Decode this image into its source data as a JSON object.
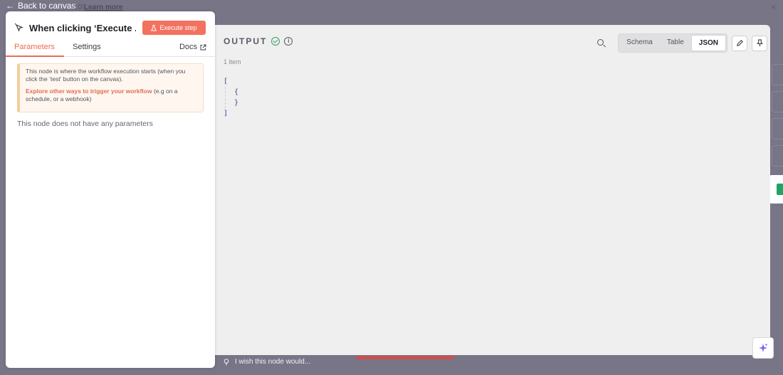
{
  "backdrop": {
    "version_fragment": "2.0!",
    "learn_more": "Learn more",
    "close_glyph": "×"
  },
  "nav": {
    "back_label": "Back to canvas"
  },
  "panel": {
    "title": "When clicking ‘Execute ...",
    "execute_label": "Execute step",
    "tabs": [
      {
        "label": "Parameters",
        "active": true
      },
      {
        "label": "Settings",
        "active": false
      }
    ],
    "docs_label": "Docs",
    "notice": {
      "line1": "This node is where the workflow execution starts (when you click the ‘test’ button on the canvas).",
      "link": "Explore other ways to trigger your workflow",
      "line2_rest": " (e.g on a schedule, or a webhook)"
    },
    "no_params": "This node does not have any parameters"
  },
  "output": {
    "title": "OUTPUT",
    "item_count": "1 item",
    "view_modes": [
      {
        "label": "Schema",
        "active": false
      },
      {
        "label": "Table",
        "active": false
      },
      {
        "label": "JSON",
        "active": true
      }
    ],
    "json_lines": [
      "[",
      "{",
      "}",
      "]"
    ]
  },
  "footer": {
    "wish_text": "I wish this node would..."
  },
  "colors": {
    "accent": "#f2725f",
    "success": "#2f9e66",
    "json_text": "#3b3f94"
  }
}
